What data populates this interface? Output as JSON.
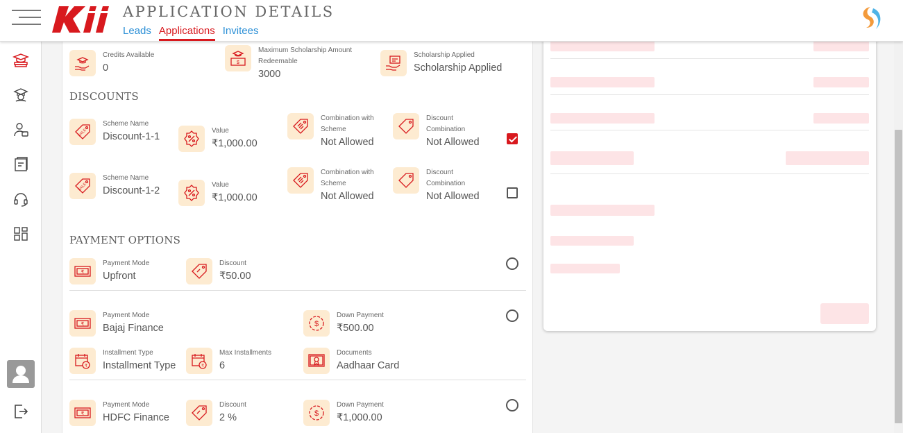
{
  "header": {
    "title": "APPLICATION DETAILS",
    "tabs": [
      {
        "label": "Leads",
        "active": false
      },
      {
        "label": "Applications",
        "active": true
      },
      {
        "label": "Invitees",
        "active": false
      }
    ],
    "logo_text": "Kii"
  },
  "sidebar": {
    "icons": [
      "graduation-books-icon",
      "graduation-cap-hand-icon",
      "user-id-icon",
      "certificate-stack-icon",
      "headset-icon",
      "grid-icon"
    ],
    "bottom": [
      "user-avatar-icon",
      "logout-icon"
    ]
  },
  "scholarship": {
    "credits": {
      "label": "Credits Available",
      "value": "0"
    },
    "max_amount": {
      "label": "Maximum Scholarship Amount Redeemable",
      "value": "3000"
    },
    "applied": {
      "label": "Scholarship Applied",
      "value": "Scholarship Applied"
    }
  },
  "discounts": {
    "title": "DISCOUNTS",
    "rows": [
      {
        "scheme_label": "Scheme Name",
        "scheme_value": "Discount-1-1",
        "value_label": "Value",
        "value": "₹1,000.00",
        "combo_scheme_label": "Combination with Scheme",
        "combo_scheme_value": "Not Allowed",
        "combo_label": "Discount Combination",
        "combo_value": "Not Allowed",
        "checked": true
      },
      {
        "scheme_label": "Scheme Name",
        "scheme_value": "Discount-1-2",
        "value_label": "Value",
        "value": "₹1,000.00",
        "combo_scheme_label": "Combination with Scheme",
        "combo_scheme_value": "Not Allowed",
        "combo_label": "Discount Combination",
        "combo_value": "Not Allowed",
        "checked": false
      }
    ]
  },
  "payment": {
    "title": "PAYMENT OPTIONS",
    "options": [
      {
        "mode_label": "Payment Mode",
        "mode": "Upfront",
        "discount_label": "Discount",
        "discount": "₹50.00"
      },
      {
        "mode_label": "Payment Mode",
        "mode": "Bajaj Finance",
        "down_label": "Down Payment",
        "down": "₹500.00",
        "inst_type_label": "Installment Type",
        "inst_type": "Installment Type",
        "max_inst_label": "Max Installments",
        "max_inst": "6",
        "docs_label": "Documents",
        "docs": "Aadhaar Card"
      },
      {
        "mode_label": "Payment Mode",
        "mode": "HDFC Finance",
        "discount_label": "Discount",
        "discount": "2 %",
        "down_label": "Down Payment",
        "down": "₹1,000.00"
      }
    ]
  },
  "colors": {
    "accent": "#d8191e",
    "link": "#2b8fd6",
    "icon_bg": "#fdebd1",
    "skeleton": "#fde4e6"
  }
}
